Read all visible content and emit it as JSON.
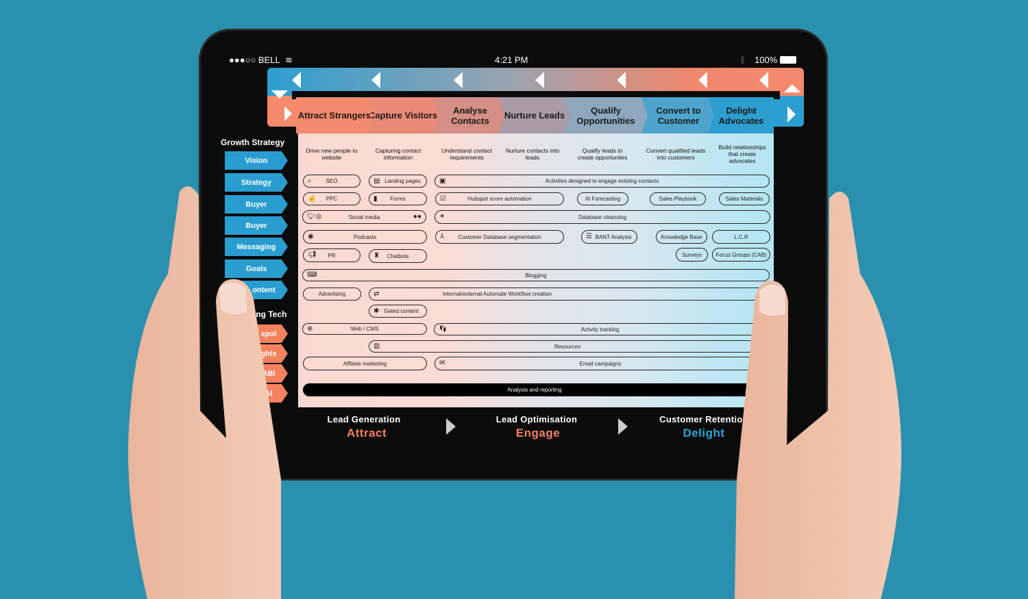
{
  "status_bar": {
    "carrier": "●●●○○ BELL",
    "time": "4:21 PM",
    "battery": "100%"
  },
  "stages": [
    {
      "label": "Attract Strangers",
      "desc": "Drive new people to website",
      "color": "#f58a6c"
    },
    {
      "label": "Capture Visitors",
      "desc": "Capturing contact information",
      "color": "#ea8a76"
    },
    {
      "label": "Analyse Contacts",
      "desc": "Understand contact requirements",
      "color": "#d48e86"
    },
    {
      "label": "Nurture Leads",
      "desc": "Nurture contacts into leads",
      "color": "#a89aa7"
    },
    {
      "label": "Qualify Opportunities",
      "desc": "Qualify leads to create opportunites",
      "color": "#8ea7bd"
    },
    {
      "label": "Convert to Customer",
      "desc": "Convert qualified leads into customers",
      "color": "#4ea4cd"
    },
    {
      "label": "Delight Advocates",
      "desc": "Build relationships that create advocates",
      "color": "#2c9fd0"
    }
  ],
  "sidebar": {
    "growth_title": "Growth Strategy",
    "growth_items": [
      "Vision",
      "Strategy",
      "Buyer",
      "Buyer",
      "Messaging",
      "Goals",
      "ontent"
    ],
    "tech_title": "ing Tech",
    "tech_items": [
      "spot",
      "ghts",
      "ABI",
      "AI"
    ]
  },
  "activities": {
    "seo": "SEO",
    "landing": "Landing pages",
    "engage": "Activities designed to engage existing contacts",
    "ppc": "PPC",
    "forms": "Forms",
    "hubspot": "Hubspot score automation",
    "ai": "AI Forecasting",
    "playbook": "Sales Playbook",
    "materials": "Sales Materials",
    "social": "Social media",
    "cleansing": "Database cleansing",
    "podcasts": "Podcasts",
    "segmentation": "Customer Database segmentation",
    "bant": "BANT Analysis",
    "kb": "Knowledge Base",
    "lcr": "L.C.R",
    "pr": "PR",
    "chatbots": "Chatbots",
    "surveys": "Surveys",
    "focus": "Focus Groups (CAB)",
    "blogging": "Blogging",
    "advertising": "Advertising",
    "workflow": "Internal/external Automate Workflow creation",
    "gated": "Gated content",
    "web": "Web / CMS",
    "tracking": "Activity tracking",
    "resources": "Resources",
    "affiliate": "Affiliate marketing",
    "email": "Email campaigns",
    "analysis": "Analysis and reporting"
  },
  "bottom": [
    {
      "title": "Lead Generation",
      "word": "Attract",
      "color": "#f5825f"
    },
    {
      "title": "Lead Optimisation",
      "word": "Engage",
      "color": "#f5825f"
    },
    {
      "title": "Customer Retention",
      "word": "Delight",
      "color": "#2aa6dc"
    }
  ]
}
